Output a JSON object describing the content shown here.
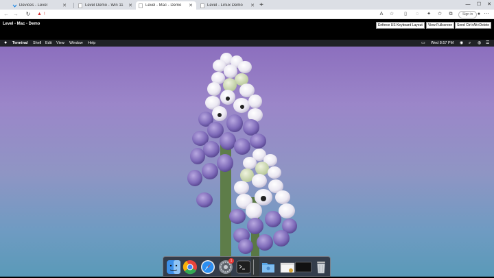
{
  "browser": {
    "tabs": [
      {
        "title": "Devices - Level",
        "active": false
      },
      {
        "title": "Level Demo - Win 11",
        "active": false
      },
      {
        "title": "Level - Mac - Demo",
        "active": true
      },
      {
        "title": "Level - Linux Demo",
        "active": false
      }
    ],
    "address_warning": "!",
    "signin_label": "Sign in"
  },
  "session": {
    "title": "Level - Mac - Demo",
    "buttons": [
      "Enforce US Keyboard Layout",
      "View Fullscreen",
      "Send Ctrl+Alt+Delete"
    ]
  },
  "mac": {
    "app_name": "Terminal",
    "menus": [
      "Shell",
      "Edit",
      "View",
      "Window",
      "Help"
    ],
    "clock": "Wed 8:57 PM"
  },
  "dock": {
    "items": [
      "finder-icon",
      "chrome-icon",
      "safari-icon",
      "system-preferences-icon",
      "terminal-icon",
      "folder-icon",
      "finder-window-icon",
      "screen-thumbnail-icon",
      "trash-icon"
    ],
    "badge": "1"
  },
  "colors": {
    "desktop_top": "#8c6fbe",
    "desktop_bottom": "#5a9ab8",
    "session_bar": "#000000",
    "menubar": "#202226"
  }
}
